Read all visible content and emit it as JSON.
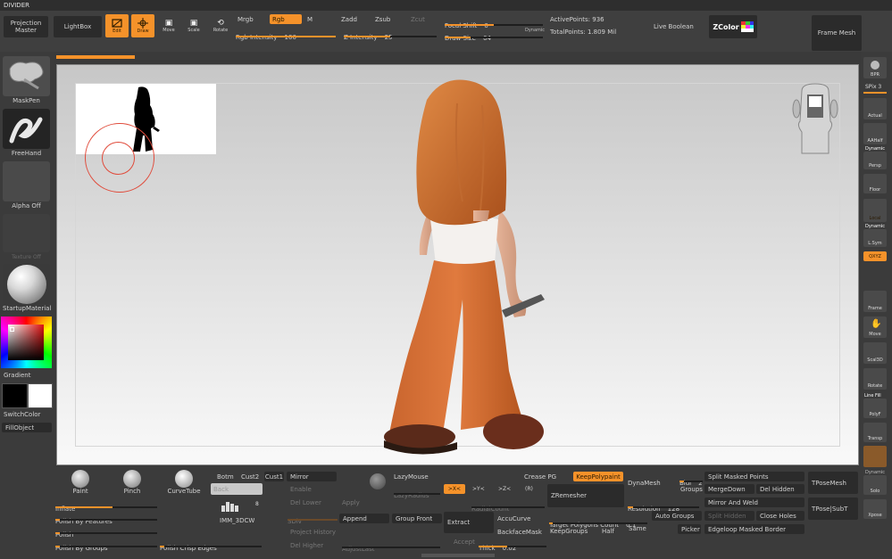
{
  "title": "DIVIDER",
  "top": {
    "projection_master": [
      "Projection",
      "Master"
    ],
    "lightbox": "LightBox",
    "edit": "Edit",
    "draw": "Draw",
    "move": "Move",
    "scale": "Scale",
    "rotate": "Rotate",
    "mrgb": "Mrgb",
    "rgb": "Rgb",
    "m": "M",
    "rgb_intensity_label": "Rgb Intensity",
    "rgb_intensity": "100",
    "zadd": "Zadd",
    "zsub": "Zsub",
    "zcut": "Zcut",
    "z_intensity_label": "Z Intensity",
    "z_intensity": "25",
    "focal_shift_label": "Focal Shift",
    "focal_shift": "0",
    "draw_size_label": "Draw Size",
    "draw_size": "64",
    "dynamic": "Dynamic",
    "active_points": "ActivePoints: 936",
    "total_points": "TotalPoints: 1.809 Mil",
    "live_boolean": "Live Boolean",
    "zcolor": "ZColor",
    "frame_mesh": "Frame Mesh"
  },
  "left": {
    "maskpen": "MaskPen",
    "freehand": "FreeHand",
    "alpha_off": "Alpha Off",
    "texture_off": "Texture Off",
    "startup_material": "StartupMaterial",
    "gradient": "Gradient",
    "switch_color": "SwitchColor",
    "fill_object": "FillObject"
  },
  "right": {
    "bpr": "BPR",
    "spix": "SPix 3",
    "actual": "Actual",
    "aahalf": "AAHalf",
    "dynamic": "Dynamic",
    "persp": "Persp",
    "floor": "Floor",
    "local": "Local",
    "dynamic2": "Dynamic",
    "lsym": "L.Sym",
    "qxyz": "QXYZ",
    "frame": "Frame",
    "move": "Move",
    "scale3d": "Scal3D",
    "rotate": "Rotate",
    "line_fill": "Line Fill",
    "polyf": "PolyF",
    "transp": "Transp",
    "dynamic3": "Dynamic",
    "solo": "Solo",
    "xpose": "Xpose"
  },
  "bottom": {
    "brushes": [
      "Paint",
      "Pinch",
      "CurveTube"
    ],
    "inflate": "Inflate",
    "polish_by_features": "Polish By Features",
    "polish": "Polish",
    "polish_by_groups": "Polish By Groups",
    "polish_crisp_edges": "Polish Crisp Edges",
    "botm": "Botm",
    "cust2": "Cust2",
    "cust1": "Cust1",
    "back": "Back",
    "imm_name": "IMM_3DCW",
    "imm_count": "8",
    "mirror": "Mirror",
    "enable": "Enable",
    "del_lower": "Del Lower",
    "sdiv": "SDiv",
    "project_history": "Project History",
    "del_higher": "Del Higher",
    "apply": "Apply",
    "append": "Append",
    "adjust_last": "AdjustLast",
    "lazymouse": "LazyMouse",
    "lazyradius": "LazyRadius",
    "group_front": "Group Front",
    "axis_x": ">X<",
    "axis_y": ">Y<",
    "axis_z": ">Z<",
    "axis_r": "(R)",
    "radial_count": "RadialCount",
    "extract": "Extract",
    "accept": "Accept",
    "accucurve": "AccuCurve",
    "backface_mask": "BackfaceMask",
    "thick_label": "Thick",
    "thick": "0.02",
    "crease_pg": "Crease PG",
    "keep_polypaint": "KeepPolypaint",
    "zremesher": "ZRemesher",
    "target_polygons_label": "Target Polygons Count",
    "target_polygons": "0.1",
    "keep_groups": "KeepGroups",
    "half": "Half",
    "dynamesh": "DynaMesh",
    "resolution_label": "Resolution",
    "resolution": "128",
    "same": "Same",
    "blur_label": "Blur",
    "blur": "2",
    "groups": "Groups",
    "auto_groups": "Auto Groups",
    "picker": "Picker",
    "split_masked_points": "Split Masked Points",
    "merge_down": "MergeDown",
    "del_hidden": "Del Hidden",
    "mirror_and_weld": "Mirror And Weld",
    "split_hidden": "Split Hidden",
    "close_holes": "Close Holes",
    "edgeloop_masked_border": "Edgeloop Masked Border",
    "tpose_mesh": "TPoseMesh",
    "tpose_subt": "TPose|SubT"
  },
  "colors": {
    "accent": "#f5922a",
    "ui_bg": "#3a3a3a",
    "canvas_top": "#c9c9c9",
    "canvas_bottom": "#fbfbfb"
  }
}
